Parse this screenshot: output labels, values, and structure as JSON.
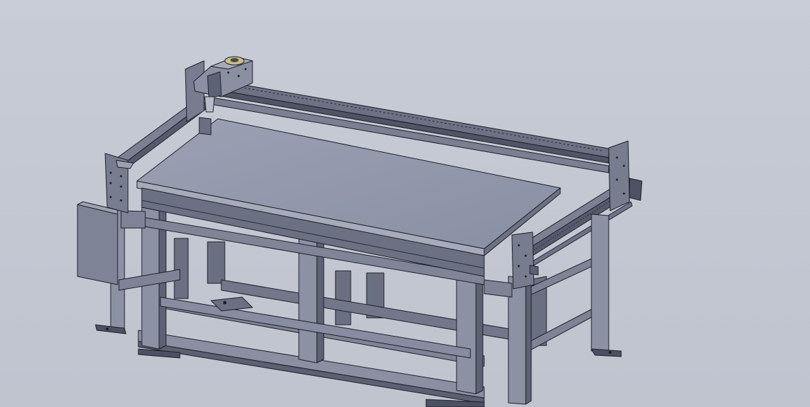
{
  "scene": {
    "type": "cad-model-viewport",
    "subject": "cnc-gantry-router-on-steel-table",
    "background_color": "#c5cad5",
    "part_color": "#8e94a6",
    "part_dark_color": "#5d6275",
    "part_light_color": "#a7acbd",
    "edge_color": "#1d1f26"
  }
}
